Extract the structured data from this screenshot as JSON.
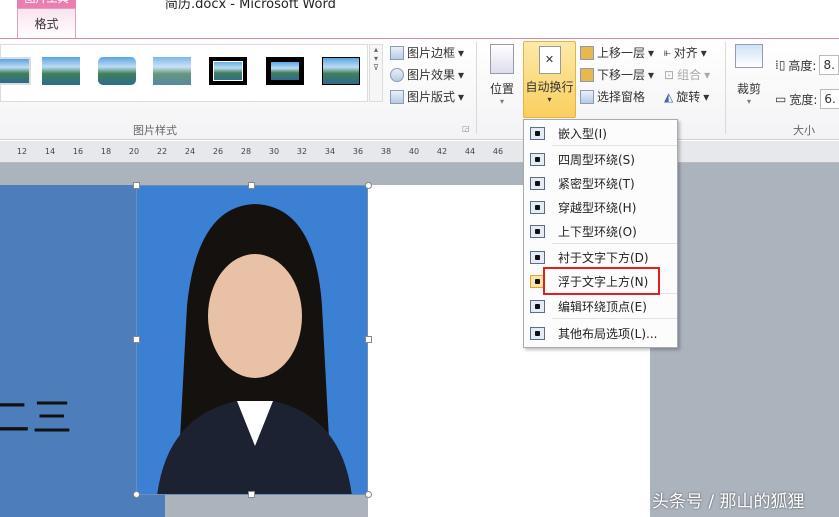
{
  "window": {
    "title": "简历.docx - Microsoft Word",
    "context_tab": "图片工具",
    "active_tab": "格式"
  },
  "ribbon": {
    "picture_styles": {
      "group_label": "图片样式",
      "border": "图片边框",
      "effects": "图片效果",
      "layout": "图片版式"
    },
    "arrange": {
      "position": "位置",
      "wrap_text": "自动换行",
      "bring_forward": "上移一层",
      "send_backward": "下移一层",
      "selection_pane": "选择窗格",
      "align": "对齐",
      "group": "组合",
      "rotate": "旋转"
    },
    "size": {
      "crop": "裁剪",
      "height_label": "高度:",
      "height_value": "8.",
      "width_label": "宽度:",
      "width_value": "6.",
      "group_label": "大小"
    }
  },
  "ruler": {
    "ticks": [
      "12",
      "14",
      "16",
      "18",
      "20",
      "22",
      "24",
      "26",
      "28",
      "30",
      "32",
      "34",
      "36",
      "38",
      "40",
      "42",
      "44",
      "46"
    ]
  },
  "document": {
    "text": "二三"
  },
  "wrap_menu": {
    "items": [
      "嵌入型(I)",
      "四周型环绕(S)",
      "紧密型环绕(T)",
      "穿越型环绕(H)",
      "上下型环绕(O)",
      "衬于文字下方(D)",
      "浮于文字上方(N)",
      "编辑环绕顶点(E)",
      "其他布局选项(L)..."
    ],
    "highlighted": "浮于文字上方(N)"
  },
  "watermark": "头条号 / 那山的狐狸",
  "colors": {
    "accent": "#e97fb0",
    "highlight_box": "#e02020",
    "active_button": "#fbd66a"
  }
}
